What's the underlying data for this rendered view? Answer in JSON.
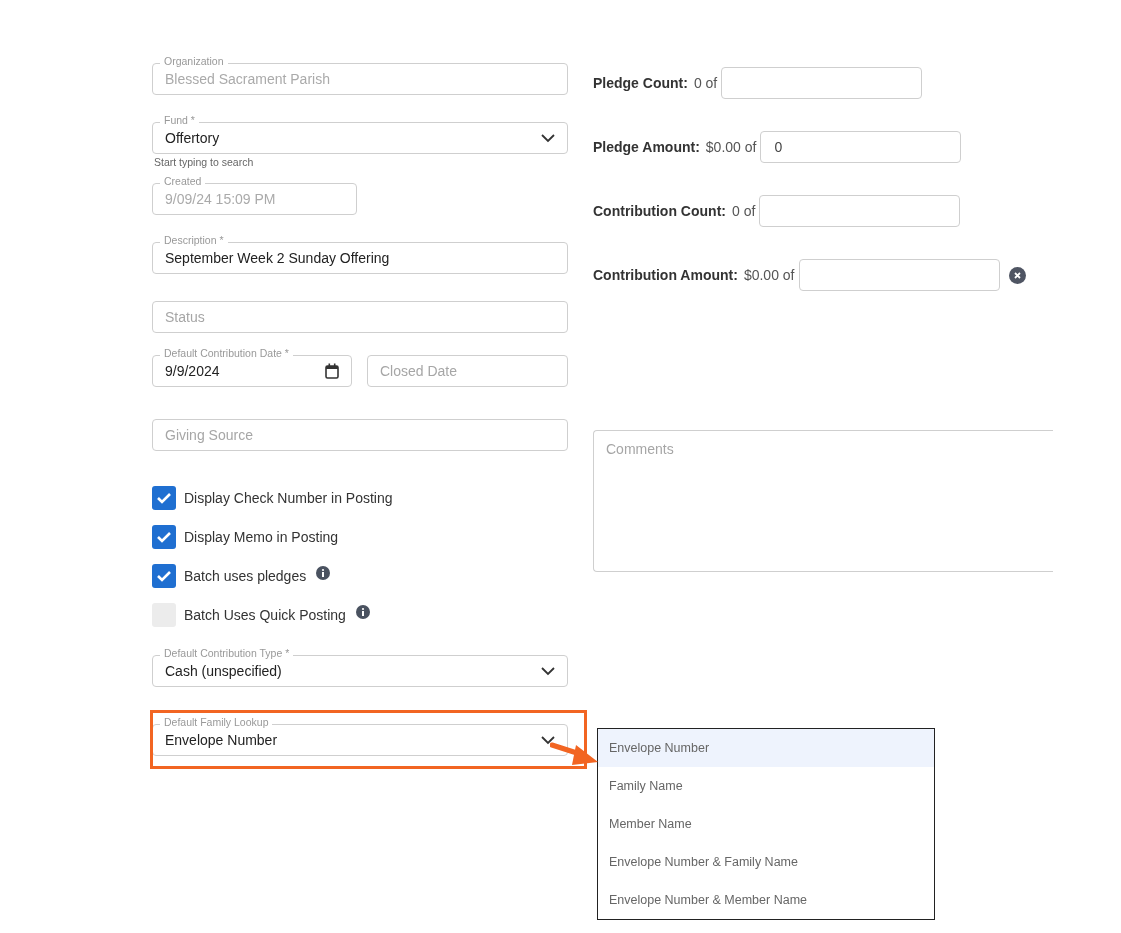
{
  "left": [
    {
      "kind": "field",
      "label": "Organization",
      "value": "Blessed Sacrament Parish",
      "disabled": true
    },
    {
      "kind": "select",
      "label": "Fund *",
      "value": "Offertory",
      "helper": "Start typing to search"
    },
    {
      "kind": "short_field",
      "label": "Created",
      "value": "9/09/24 15:09 PM",
      "disabled": true
    },
    {
      "kind": "field",
      "label": "Description *",
      "value": "September Week 2 Sunday Offering",
      "disabled": false
    },
    {
      "kind": "field",
      "placeholder": "Status"
    },
    {
      "kind": "date_row",
      "date": {
        "label": "Default Contribution Date *",
        "value": "9/9/2024"
      },
      "closed": {
        "placeholder": "Closed Date"
      }
    },
    {
      "kind": "field",
      "placeholder": "Giving Source"
    },
    {
      "kind": "checkbox",
      "label": "Display Check Number in Posting",
      "checked": true,
      "info": false
    },
    {
      "kind": "checkbox",
      "label": "Display Memo in Posting",
      "checked": true,
      "info": false
    },
    {
      "kind": "checkbox",
      "label": "Batch uses pledges",
      "checked": true,
      "info": true
    },
    {
      "kind": "checkbox",
      "label": "Batch Uses Quick Posting",
      "checked": false,
      "info": true
    },
    {
      "kind": "select",
      "label": "Default Contribution Type *",
      "value": "Cash (unspecified)"
    },
    {
      "kind": "select",
      "label": "Default Family Lookup",
      "value": "Envelope Number",
      "highlighted": true,
      "expanded": true,
      "options": [
        {
          "label": "Envelope Number",
          "selected": true
        },
        {
          "label": "Family Name",
          "selected": false
        },
        {
          "label": "Member Name",
          "selected": false
        },
        {
          "label": "Envelope Number & Family Name",
          "selected": false
        },
        {
          "label": "Envelope Number & Member Name",
          "selected": false
        }
      ]
    }
  ],
  "totals": [
    {
      "label": "Pledge Count:",
      "total": "0 of",
      "clearable": false
    },
    {
      "label": "Pledge Amount:",
      "total": "$0.00 of",
      "value": "0",
      "clearable": false
    },
    {
      "label": "Contribution Count:",
      "total": "0 of",
      "clearable": false
    },
    {
      "label": "Contribution Amount:",
      "total": "$0.00 of",
      "clearable": true
    }
  ],
  "comments": {
    "placeholder": "Comments"
  }
}
